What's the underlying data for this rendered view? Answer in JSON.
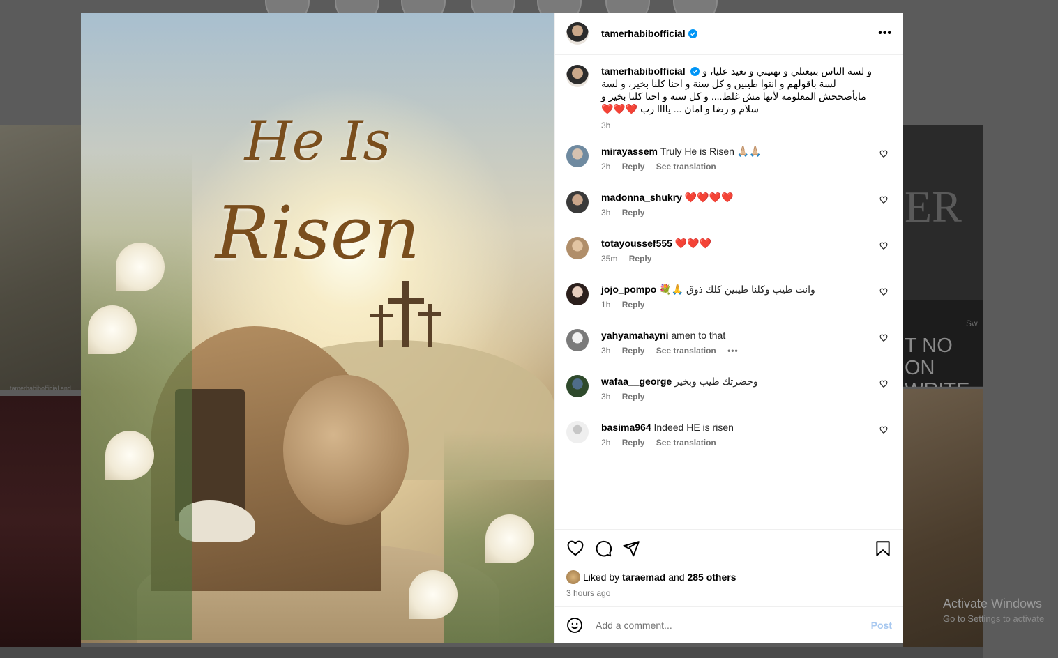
{
  "watermark": {
    "title": "Activate Windows",
    "subtitle": "Go to Settings to activate"
  },
  "background": {
    "right_tile_big": "ER",
    "right_tile_text": "T NO ON WRITE",
    "right_tile_small": "Sw",
    "left_caption": "tamerhabibofficial and"
  },
  "post": {
    "art_line1": "He Is",
    "art_line2": "Risen",
    "author": "tamerhabibofficial",
    "more_label": "•••",
    "caption": "و لسة الناس بتبعتلي و تهنيني و تعيد عليا، و لسة باقولهم و انتوا طيبين و كل سنة و احنا كلنا بخير، و لسة مابأصححش المعلومة لأنها مش غلط.... و كل سنة و احنا كلنا بخير و سلام و رضا و امان ... ياااا رب ❤️❤️❤️",
    "caption_time": "3h"
  },
  "comments": [
    {
      "user": "mirayassem",
      "text": "Truly He is Risen 🙏🏼🙏🏼",
      "time": "2h",
      "reply": "Reply",
      "translate": "See translation",
      "more": ""
    },
    {
      "user": "madonna_shukry",
      "text": "❤️❤️❤️❤️",
      "time": "3h",
      "reply": "Reply",
      "translate": "",
      "more": ""
    },
    {
      "user": "totayoussef555",
      "text": "❤️❤️❤️",
      "time": "35m",
      "reply": "Reply",
      "translate": "",
      "more": ""
    },
    {
      "user": "jojo_pompo",
      "text": "وانت طيب وكلنا طيبين كلك ذوق 🙏💐",
      "time": "1h",
      "reply": "Reply",
      "translate": "",
      "more": ""
    },
    {
      "user": "yahyamahayni",
      "text": "amen to that",
      "time": "3h",
      "reply": "Reply",
      "translate": "See translation",
      "more": "•••"
    },
    {
      "user": "wafaa__george",
      "text": "وحضرتك طيب وبخير",
      "time": "3h",
      "reply": "Reply",
      "translate": "",
      "more": ""
    },
    {
      "user": "basima964",
      "text": "Indeed HE is risen",
      "time": "2h",
      "reply": "Reply",
      "translate": "See translation",
      "more": ""
    }
  ],
  "likes": {
    "prefix": "Liked by",
    "user": "taraemad",
    "and": "and",
    "others": "285 others",
    "ago": "3 hours ago"
  },
  "add_comment": {
    "placeholder": "Add a comment...",
    "post_label": "Post"
  },
  "colors": {
    "accent": "#0095f6",
    "verified": "#0095f6",
    "like_red": "#ed4956"
  }
}
